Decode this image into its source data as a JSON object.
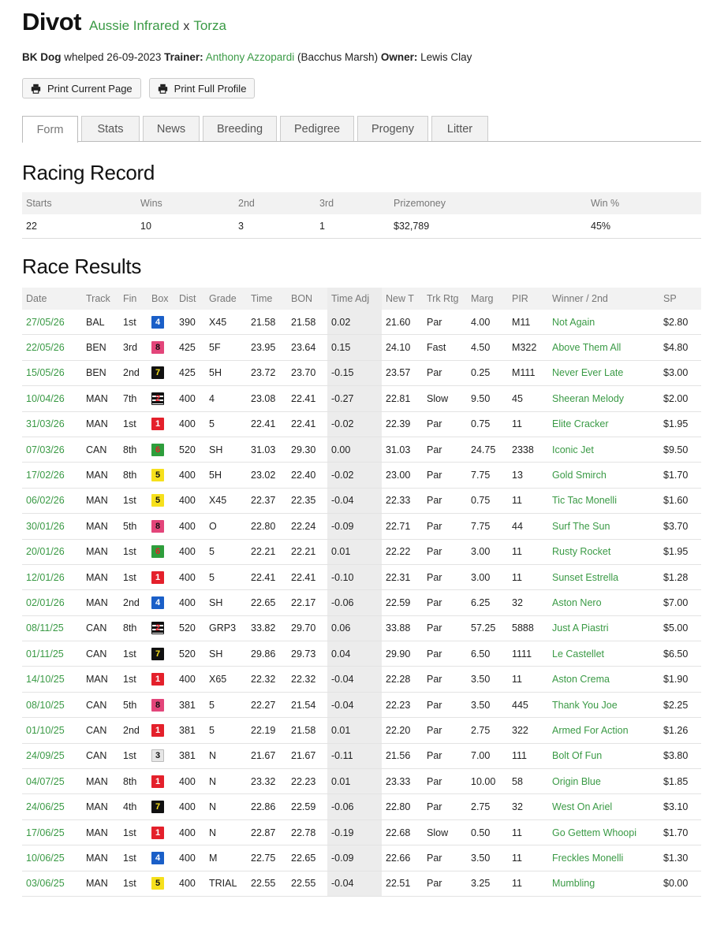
{
  "dog": {
    "name": "Divot",
    "sire": "Aussie Infrared",
    "sep": "x",
    "dam": "Torza"
  },
  "meta": {
    "type": "BK Dog",
    "whelped": "whelped 26-09-2023",
    "trainer_label": "Trainer:",
    "trainer": "Anthony Azzopardi",
    "trainer_loc": "(Bacchus Marsh)",
    "owner_label": "Owner:",
    "owner": "Lewis Clay"
  },
  "buttons": {
    "print_current": "Print Current Page",
    "print_full": "Print Full Profile"
  },
  "tabs": [
    "Form",
    "Stats",
    "News",
    "Breeding",
    "Pedigree",
    "Progeny",
    "Litter"
  ],
  "racing_record": {
    "title": "Racing Record",
    "headers": [
      "Starts",
      "Wins",
      "2nd",
      "3rd",
      "Prizemoney",
      "Win %"
    ],
    "values": [
      "22",
      "10",
      "3",
      "1",
      "$32,789",
      "45%"
    ]
  },
  "race_results": {
    "title": "Race Results",
    "headers": [
      "Date",
      "Track",
      "Fin",
      "Box",
      "Dist",
      "Grade",
      "Time",
      "BON",
      "Time Adj",
      "New T",
      "Trk Rtg",
      "Marg",
      "PIR",
      "Winner / 2nd",
      "SP"
    ],
    "rows": [
      [
        "27/05/26",
        "BAL",
        "1st",
        "4",
        "390",
        "X45",
        "21.58",
        "21.58",
        "0.02",
        "21.60",
        "Par",
        "4.00",
        "M11",
        "Not Again",
        "$2.80"
      ],
      [
        "22/05/26",
        "BEN",
        "3rd",
        "8",
        "425",
        "5F",
        "23.95",
        "23.64",
        "0.15",
        "24.10",
        "Fast",
        "4.50",
        "M322",
        "Above Them All",
        "$4.80"
      ],
      [
        "15/05/26",
        "BEN",
        "2nd",
        "7",
        "425",
        "5H",
        "23.72",
        "23.70",
        "-0.15",
        "23.57",
        "Par",
        "0.25",
        "M111",
        "Never Ever Late",
        "$3.00"
      ],
      [
        "10/04/26",
        "MAN",
        "7th",
        "2",
        "400",
        "4",
        "23.08",
        "22.41",
        "-0.27",
        "22.81",
        "Slow",
        "9.50",
        "45",
        "Sheeran Melody",
        "$2.00"
      ],
      [
        "31/03/26",
        "MAN",
        "1st",
        "1",
        "400",
        "5",
        "22.41",
        "22.41",
        "-0.02",
        "22.39",
        "Par",
        "0.75",
        "11",
        "Elite Cracker",
        "$1.95"
      ],
      [
        "07/03/26",
        "CAN",
        "8th",
        "6",
        "520",
        "SH",
        "31.03",
        "29.30",
        "0.00",
        "31.03",
        "Par",
        "24.75",
        "2338",
        "Iconic Jet",
        "$9.50"
      ],
      [
        "17/02/26",
        "MAN",
        "8th",
        "5",
        "400",
        "5H",
        "23.02",
        "22.40",
        "-0.02",
        "23.00",
        "Par",
        "7.75",
        "13",
        "Gold Smirch",
        "$1.70"
      ],
      [
        "06/02/26",
        "MAN",
        "1st",
        "5",
        "400",
        "X45",
        "22.37",
        "22.35",
        "-0.04",
        "22.33",
        "Par",
        "0.75",
        "11",
        "Tic Tac Monelli",
        "$1.60"
      ],
      [
        "30/01/26",
        "MAN",
        "5th",
        "8",
        "400",
        "O",
        "22.80",
        "22.24",
        "-0.09",
        "22.71",
        "Par",
        "7.75",
        "44",
        "Surf The Sun",
        "$3.70"
      ],
      [
        "20/01/26",
        "MAN",
        "1st",
        "6",
        "400",
        "5",
        "22.21",
        "22.21",
        "0.01",
        "22.22",
        "Par",
        "3.00",
        "11",
        "Rusty Rocket",
        "$1.95"
      ],
      [
        "12/01/26",
        "MAN",
        "1st",
        "1",
        "400",
        "5",
        "22.41",
        "22.41",
        "-0.10",
        "22.31",
        "Par",
        "3.00",
        "11",
        "Sunset Estrella",
        "$1.28"
      ],
      [
        "02/01/26",
        "MAN",
        "2nd",
        "4",
        "400",
        "SH",
        "22.65",
        "22.17",
        "-0.06",
        "22.59",
        "Par",
        "6.25",
        "32",
        "Aston Nero",
        "$7.00"
      ],
      [
        "08/11/25",
        "CAN",
        "8th",
        "2",
        "520",
        "GRP3",
        "33.82",
        "29.70",
        "0.06",
        "33.88",
        "Par",
        "57.25",
        "5888",
        "Just A Piastri",
        "$5.00"
      ],
      [
        "01/11/25",
        "CAN",
        "1st",
        "7",
        "520",
        "SH",
        "29.86",
        "29.73",
        "0.04",
        "29.90",
        "Par",
        "6.50",
        "1111",
        "Le Castellet",
        "$6.50"
      ],
      [
        "14/10/25",
        "MAN",
        "1st",
        "1",
        "400",
        "X65",
        "22.32",
        "22.32",
        "-0.04",
        "22.28",
        "Par",
        "3.50",
        "11",
        "Aston Crema",
        "$1.90"
      ],
      [
        "08/10/25",
        "CAN",
        "5th",
        "8",
        "381",
        "5",
        "22.27",
        "21.54",
        "-0.04",
        "22.23",
        "Par",
        "3.50",
        "445",
        "Thank You Joe",
        "$2.25"
      ],
      [
        "01/10/25",
        "CAN",
        "2nd",
        "1",
        "381",
        "5",
        "22.19",
        "21.58",
        "0.01",
        "22.20",
        "Par",
        "2.75",
        "322",
        "Armed For Action",
        "$1.26"
      ],
      [
        "24/09/25",
        "CAN",
        "1st",
        "3",
        "381",
        "N",
        "21.67",
        "21.67",
        "-0.11",
        "21.56",
        "Par",
        "7.00",
        "111",
        "Bolt Of Fun",
        "$3.80"
      ],
      [
        "04/07/25",
        "MAN",
        "8th",
        "1",
        "400",
        "N",
        "23.32",
        "22.23",
        "0.01",
        "23.33",
        "Par",
        "10.00",
        "58",
        "Origin Blue",
        "$1.85"
      ],
      [
        "24/06/25",
        "MAN",
        "4th",
        "7",
        "400",
        "N",
        "22.86",
        "22.59",
        "-0.06",
        "22.80",
        "Par",
        "2.75",
        "32",
        "West On Ariel",
        "$3.10"
      ],
      [
        "17/06/25",
        "MAN",
        "1st",
        "1",
        "400",
        "N",
        "22.87",
        "22.78",
        "-0.19",
        "22.68",
        "Slow",
        "0.50",
        "11",
        "Go Gettem Whoopi",
        "$1.70"
      ],
      [
        "10/06/25",
        "MAN",
        "1st",
        "4",
        "400",
        "M",
        "22.75",
        "22.65",
        "-0.09",
        "22.66",
        "Par",
        "3.50",
        "11",
        "Freckles Monelli",
        "$1.30"
      ],
      [
        "03/06/25",
        "MAN",
        "1st",
        "5",
        "400",
        "TRIAL",
        "22.55",
        "22.55",
        "-0.04",
        "22.51",
        "Par",
        "3.25",
        "11",
        "Mumbling",
        "$0.00"
      ]
    ]
  },
  "colors": {
    "link": "#3a9a45",
    "header_bg": "#f2f2f2",
    "adj_bg": "#ececec"
  },
  "icons": {
    "print": "printer-icon"
  }
}
